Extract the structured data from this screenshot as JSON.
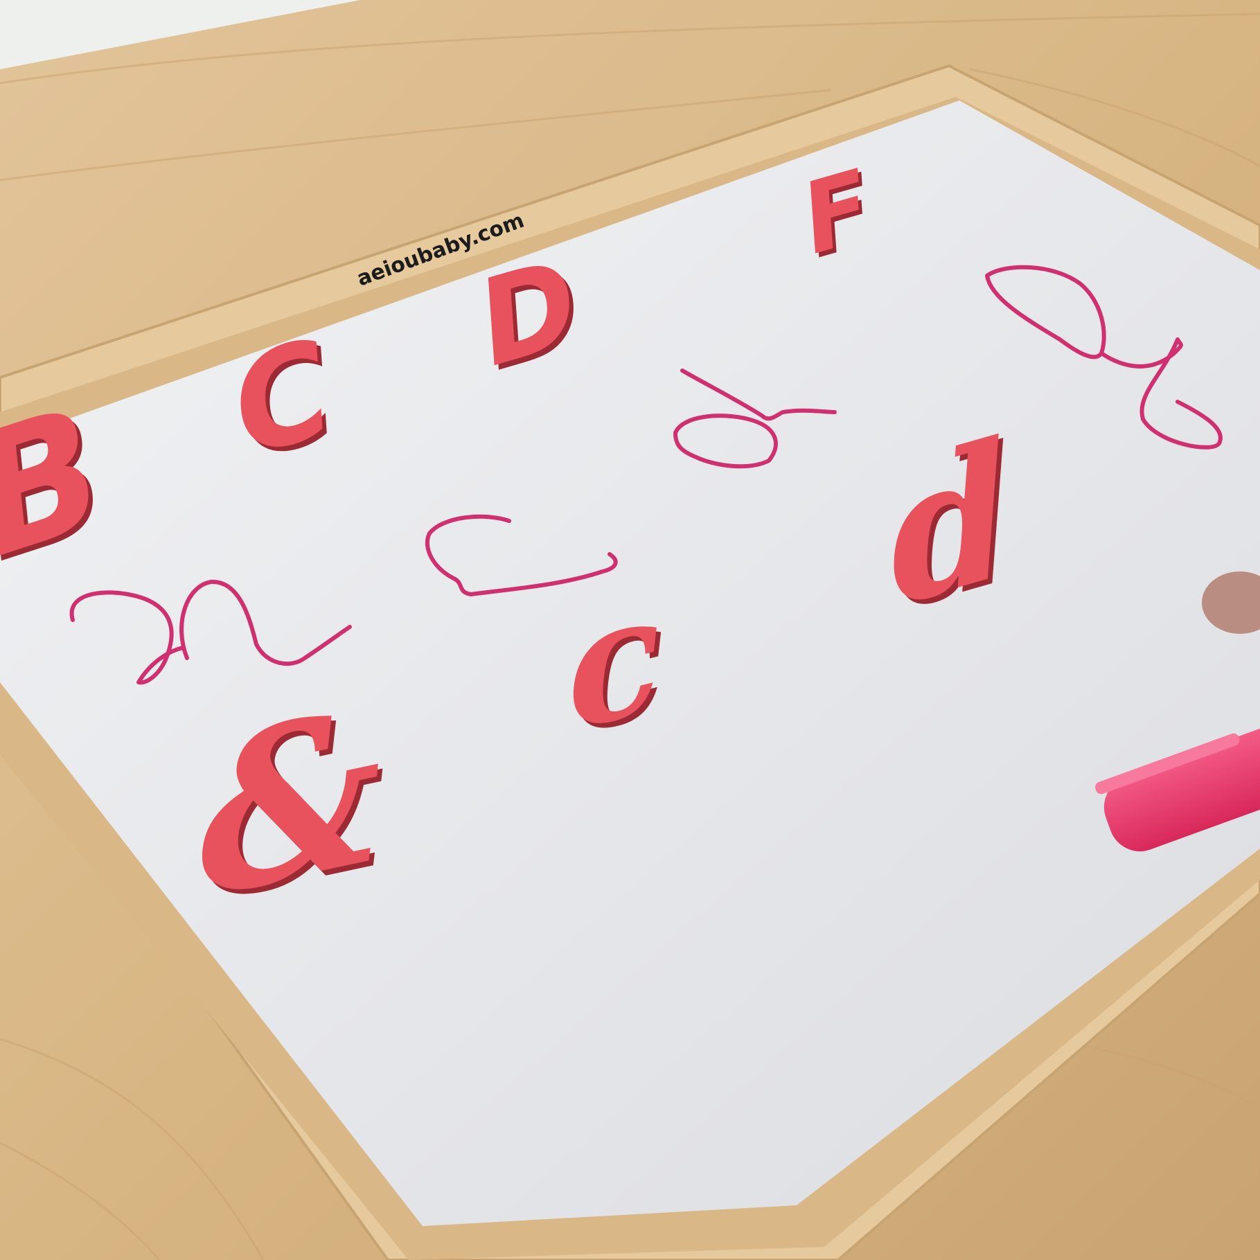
{
  "scene": {
    "description_colors": {
      "table": "#d9b88b",
      "frame": "#e4c89a",
      "board": "#e9eaec",
      "foam_letter": "#e8525d",
      "marker_ink": "#d0306f",
      "marker_pen": "#ee3f72"
    }
  },
  "board": {
    "brand_label": "aeioubaby.com"
  },
  "foam_letters": {
    "upper": [
      "B",
      "C",
      "D",
      "F"
    ],
    "lower": [
      "c",
      "d"
    ],
    "ampersand": "&"
  }
}
